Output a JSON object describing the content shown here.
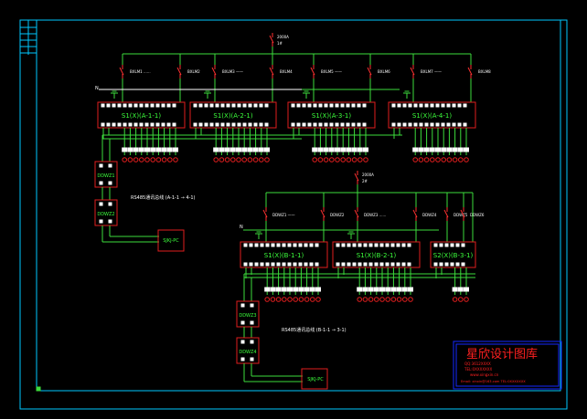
{
  "colors": {
    "frame": "#00c8ff",
    "wire": "#3cdc3c",
    "module": "#e01e1e",
    "breaker": "#ff3030",
    "text": "#ffffff",
    "module_text": "#3cff3c",
    "stamp_border": "#1428ff",
    "stamp_text": "#ff2020"
  },
  "upper": {
    "main_breaker_label": [
      "2000A",
      "1#"
    ],
    "bus_label": "N",
    "branch_labels": [
      "BXLM1 ......",
      "BXLM2",
      "BXLM3 ——",
      "BXLM4",
      "BXLM5 ——",
      "BXLM6",
      "BXLM7 ——",
      "BXLM8"
    ],
    "modules": [
      "S1(X)(A-1-1)",
      "S1(X)(A-2-1)",
      "S1(X)(A-3-1)",
      "S1(X)(A-4-1)"
    ],
    "device_boxes": [
      "DDWZ1",
      "DDWZ2"
    ],
    "pc_box": "SJKJ-PC",
    "annotation": "RS485通讯总线 (A-1-1 → 4-1)"
  },
  "lower": {
    "main_breaker_label": [
      "2000A",
      "2#"
    ],
    "bus_label": "N",
    "branch_labels": [
      "DDWZ1 ——",
      "DDWZ2",
      "DDWZ3 ......",
      "DDWZ4",
      "DDWZ5",
      "DDWZ6"
    ],
    "modules": [
      "S1(X)(B-1-1)",
      "S1(X)(B-2-1)",
      "S2(X)(B-3-1)"
    ],
    "device_boxes": [
      "DDWZ3",
      "DDWZ4"
    ],
    "pc_box": "SJKJ-PC",
    "annotation": "RS485通讯总线 (B-1-1 → 3-1)"
  },
  "stamp": {
    "title": "星欣设计图库",
    "line1": "QQ:3612XXXX",
    "line2": "TEL:0XXXXXXX",
    "line3": "www.xingxin.cn",
    "line4": "Email: xinxin@163.com TEL:0XXXXXXX"
  }
}
